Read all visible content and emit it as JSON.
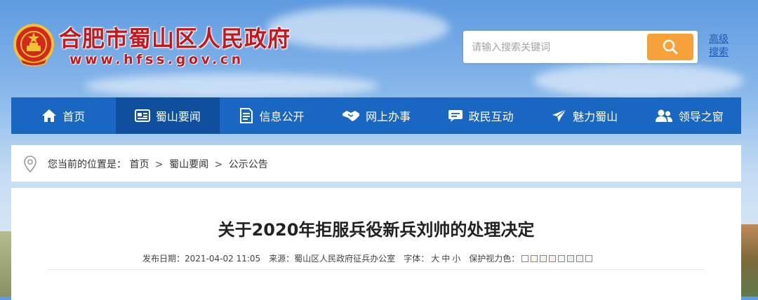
{
  "header": {
    "site_title": "合肥市蜀山区人民政府",
    "site_domain": "www.hfss.gov.cn",
    "search_placeholder": "请输入搜索关键词",
    "advanced_search": "高级搜索"
  },
  "nav": {
    "items": [
      {
        "label": "首页",
        "icon": "home-icon"
      },
      {
        "label": "蜀山要闻",
        "icon": "news-icon",
        "active": true
      },
      {
        "label": "信息公开",
        "icon": "document-icon"
      },
      {
        "label": "网上办事",
        "icon": "handshake-icon"
      },
      {
        "label": "政民互动",
        "icon": "chat-icon"
      },
      {
        "label": "魅力蜀山",
        "icon": "send-icon"
      },
      {
        "label": "领导之窗",
        "icon": "people-icon"
      }
    ]
  },
  "breadcrumb": {
    "prefix": "您当前的位置是：",
    "items": [
      "首页",
      "蜀山要闻",
      "公示公告"
    ],
    "separator": ">"
  },
  "article": {
    "title": "关于2020年拒服兵役新兵刘帅的处理决定",
    "publish_label": "发布日期：",
    "publish_date": "2021-04-02 11:05",
    "source_label": "来源：",
    "source": "蜀山区人民政府征兵办公室",
    "font_label": "字体：",
    "font_sizes": [
      "大",
      "中",
      "小"
    ],
    "eye_label": "保护视力色：",
    "eye_colors": [
      "#fafafa",
      "#fbf7e4",
      "#f4f1e5",
      "#f8e9f5",
      "#f0f7f1",
      "#e4f1ea",
      "#eef0f3",
      "#ffffff"
    ]
  },
  "colors": {
    "nav_bg": "#1967c2",
    "nav_active": "#0f4f9e",
    "title_red": "#c8161d",
    "search_button": "#f7a13a"
  }
}
